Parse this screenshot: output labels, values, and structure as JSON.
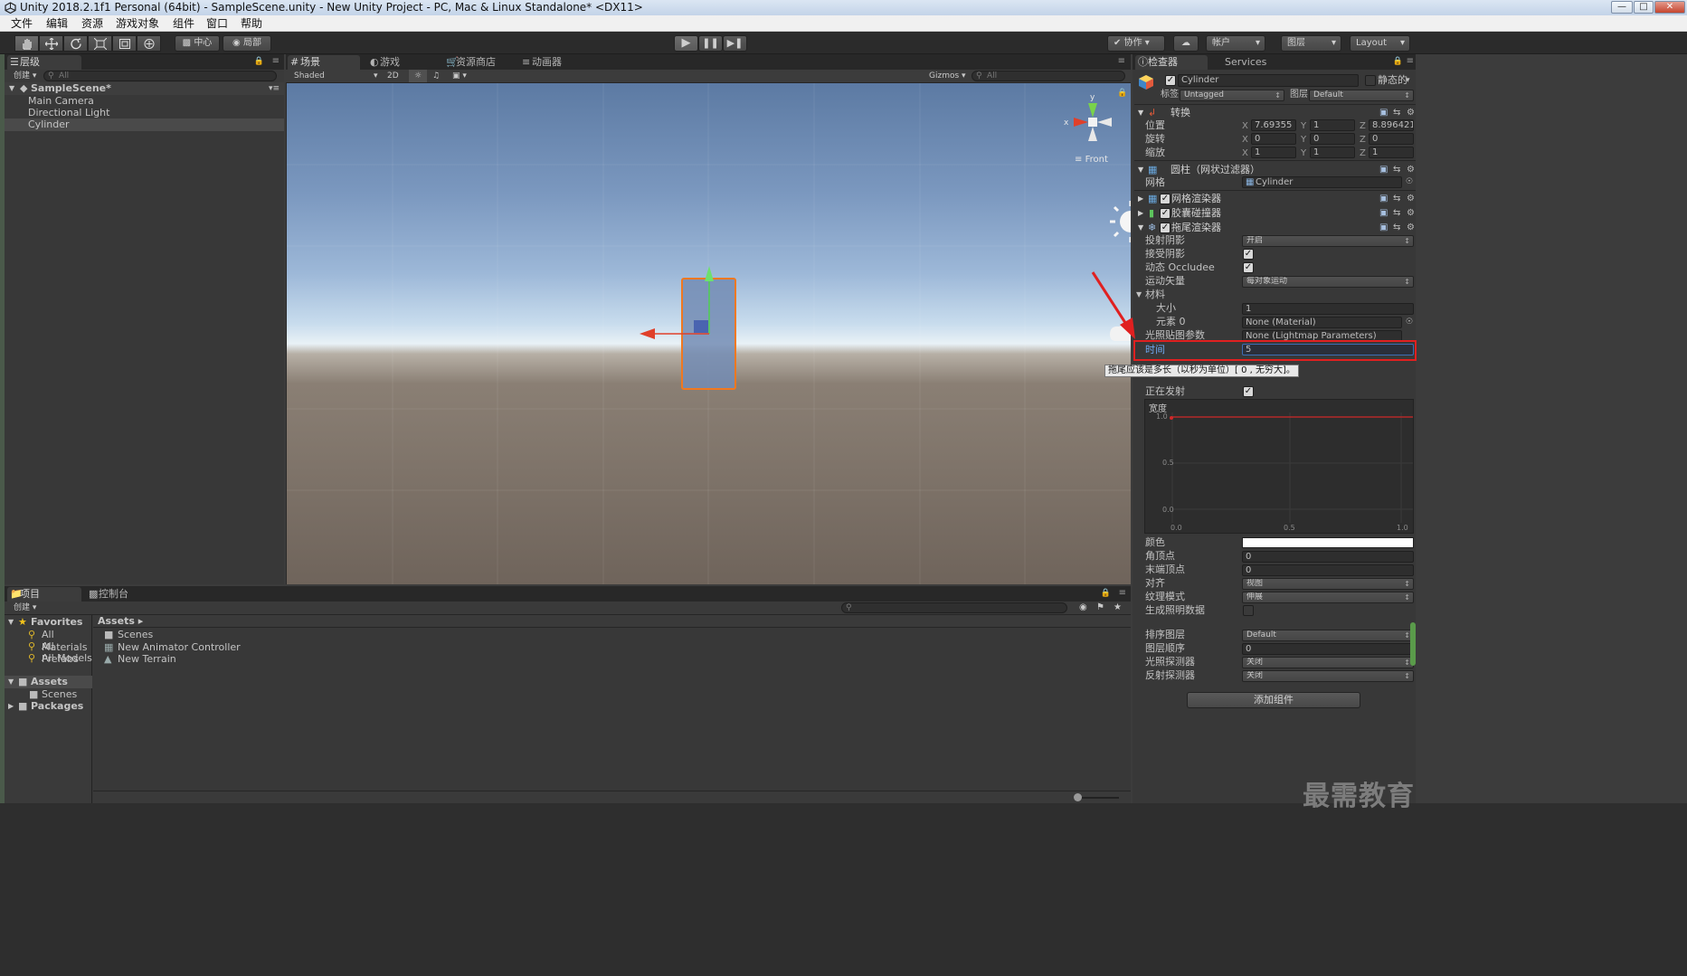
{
  "window": {
    "title": "Unity 2018.2.1f1 Personal (64bit) - SampleScene.unity - New Unity Project - PC, Mac & Linux Standalone* <DX11>",
    "buttons": [
      "—",
      "□",
      "✕"
    ]
  },
  "menu": [
    "文件",
    "编辑",
    "资源",
    "游戏对象",
    "组件",
    "窗口",
    "帮助"
  ],
  "toolbar": {
    "pivot": "中心",
    "local": "局部",
    "collab": "协作",
    "account": "帐户",
    "layers": "图层",
    "layout": "Layout"
  },
  "hierarchy": {
    "tab": "层级",
    "create": "创建",
    "search_placeholder": "All",
    "scene": "SampleScene*",
    "items": [
      "Main Camera",
      "Directional Light",
      "Cylinder"
    ]
  },
  "scene_view": {
    "tabs": [
      "场景",
      "游戏",
      "资源商店",
      "动画器"
    ],
    "shading": "Shaded",
    "mode_2d": "2D",
    "gizmos": "Gizmos",
    "search_placeholder": "All",
    "gizmo_axes": {
      "x": "x",
      "y": "y"
    },
    "persp_label": "Front"
  },
  "project": {
    "tabs": [
      "项目",
      "控制台"
    ],
    "create": "创建",
    "favorites_label": "Favorites",
    "favorites": [
      "All Materials",
      "All Prefabs",
      "All Models"
    ],
    "assets_label": "Assets",
    "assets_children": [
      "Scenes"
    ],
    "packages_label": "Packages",
    "breadcrumb": "Assets",
    "files": [
      "Scenes",
      "New Animator Controller",
      "New Terrain"
    ]
  },
  "inspector": {
    "tabs": [
      "检查器",
      "Services"
    ],
    "object_name": "Cylinder",
    "static_label": "静态的",
    "tag_label": "标签",
    "tag_value": "Untagged",
    "layer_label": "图层",
    "layer_value": "Default",
    "transform": {
      "title": "转换",
      "rows": [
        {
          "label": "位置",
          "x": "7.69355",
          "y": "1",
          "z": "8.896421"
        },
        {
          "label": "旋转",
          "x": "0",
          "y": "0",
          "z": "0"
        },
        {
          "label": "缩放",
          "x": "1",
          "y": "1",
          "z": "1"
        }
      ]
    },
    "mesh_filter": {
      "title": "圆柱（网状过滤器）",
      "mesh_label": "网格",
      "mesh_value": "Cylinder"
    },
    "mesh_renderer": "网格渲染器",
    "capsule_collider": "胶囊碰撞器",
    "trail_renderer": {
      "title": "拖尾渲染器",
      "cast_shadows_label": "投射阴影",
      "cast_shadows_value": "开启",
      "receive_shadows_label": "接受阴影",
      "dynamic_occludee_label": "动态 Occludee",
      "motion_vectors_label": "运动矢量",
      "motion_vectors_value": "每对象运动",
      "materials_label": "材料",
      "size_label": "大小",
      "size_value": "1",
      "element0_label": "元素 0",
      "element0_value": "None (Material)",
      "lightmap_label": "光照贴图参数",
      "lightmap_value": "None (Lightmap Parameters)",
      "time_label": "时间",
      "time_value": "5",
      "tooltip": "拖尾应该是多长（以秒为单位）[ 0 , 无穷大]。",
      "emitting_label": "正在发射",
      "width_label": "宽度",
      "curve_y_ticks": [
        "1.0",
        "0.5",
        "0.0"
      ],
      "curve_x_ticks": [
        "0.0",
        "0.5",
        "1.0"
      ],
      "color_label": "颜色",
      "corner_label": "角顶点",
      "corner_value": "0",
      "end_cap_label": "末端顶点",
      "end_cap_value": "0",
      "alignment_label": "对齐",
      "alignment_value": "视图",
      "texture_mode_label": "纹理模式",
      "texture_mode_value": "伸展",
      "gen_lighting_label": "生成照明数据",
      "sorting_layer_label": "排序图层",
      "sorting_layer_value": "Default",
      "order_label": "图层顺序",
      "order_value": "0",
      "light_probes_label": "光照探测器",
      "light_probes_value": "关闭",
      "reflection_probes_label": "反射探测器",
      "reflection_probes_value": "关闭"
    },
    "add_component": "添加组件"
  },
  "watermark": "最需教育",
  "colors": {
    "editor_bg": "#383838",
    "highlight": "#e02020",
    "selection_outline": "#f07820",
    "field_focus": "#3d6eb5"
  }
}
